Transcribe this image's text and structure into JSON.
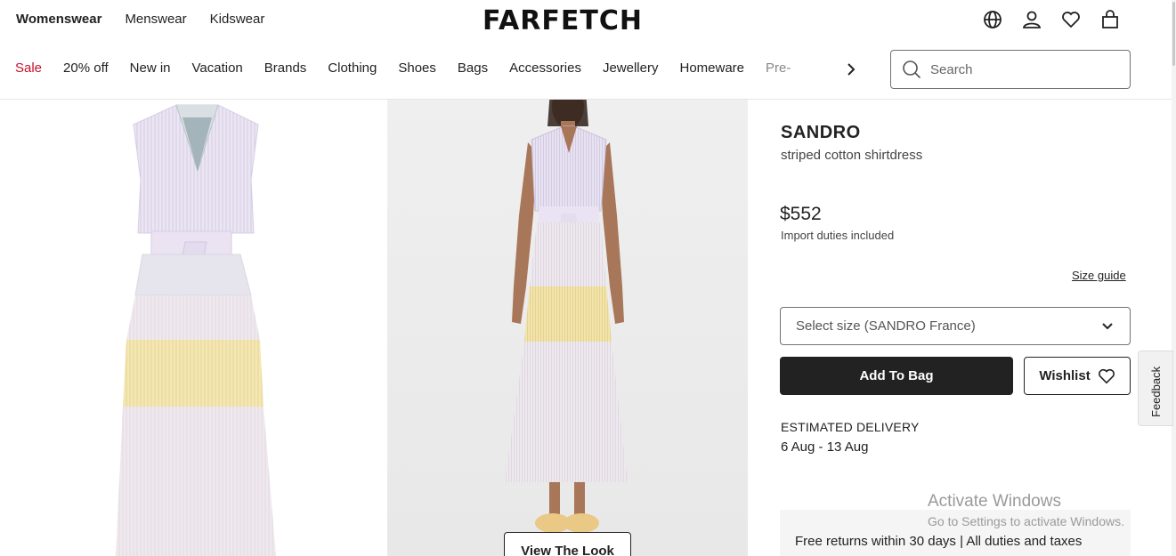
{
  "header": {
    "gender_tabs": [
      "Womenswear",
      "Menswear",
      "Kidswear"
    ],
    "logo": "FARFETCH",
    "icons": [
      "globe-icon",
      "account-icon",
      "wishlist-heart-icon",
      "shopping-bag-icon"
    ]
  },
  "categories": [
    "Sale",
    "20% off",
    "New in",
    "Vacation",
    "Brands",
    "Clothing",
    "Shoes",
    "Bags",
    "Accessories",
    "Jewellery",
    "Homeware",
    "Pre-"
  ],
  "search": {
    "placeholder": "Search"
  },
  "product": {
    "brand": "SANDRO",
    "description": "striped cotton shirtdress",
    "price": "$552",
    "duties_note": "Import duties included",
    "size_guide": "Size guide",
    "size_select": "Select size (SANDRO France)",
    "add_to_bag": "Add To Bag",
    "wishlist": "Wishlist",
    "delivery_title": "ESTIMATED DELIVERY",
    "delivery_dates": "6 Aug - 13 Aug",
    "returns_text": "Free returns within 30 days | All duties and taxes"
  },
  "gallery": {
    "view_look": "View The Look"
  },
  "feedback": "Feedback",
  "watermark": {
    "title": "Activate Windows",
    "subtitle": "Go to Settings to activate Windows."
  },
  "colors": {
    "sale": "#c8102e",
    "primary_button": "#222222"
  }
}
